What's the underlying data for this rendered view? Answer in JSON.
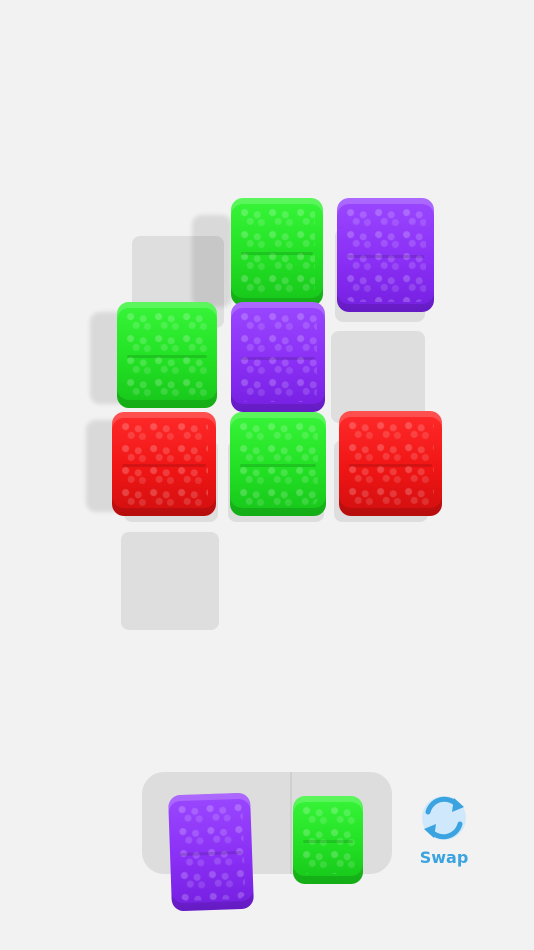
{
  "board": {
    "empty_slots": [
      "slot-r1c1",
      "slot-r2c4",
      "slot-r4c1"
    ],
    "blocks": [
      {
        "id": "r1c2",
        "color": "green"
      },
      {
        "id": "r1c3",
        "color": "purple"
      },
      {
        "id": "r2c1",
        "color": "green"
      },
      {
        "id": "r2c2",
        "color": "purple"
      },
      {
        "id": "r3c1",
        "color": "red"
      },
      {
        "id": "r3c2",
        "color": "green"
      },
      {
        "id": "r3c3",
        "color": "red"
      }
    ]
  },
  "tray": {
    "pieces": [
      {
        "id": "tray-piece-1",
        "color": "purple"
      },
      {
        "id": "tray-piece-2",
        "color": "green"
      }
    ]
  },
  "swap": {
    "label": "Swap",
    "icon": "swap-arrows-icon",
    "color": "#3aa3e0"
  },
  "colors": {
    "green": "#22e024",
    "purple": "#8a2ff5",
    "red": "#f01515",
    "background": "#f2f2f2",
    "slot": "#dedede"
  }
}
